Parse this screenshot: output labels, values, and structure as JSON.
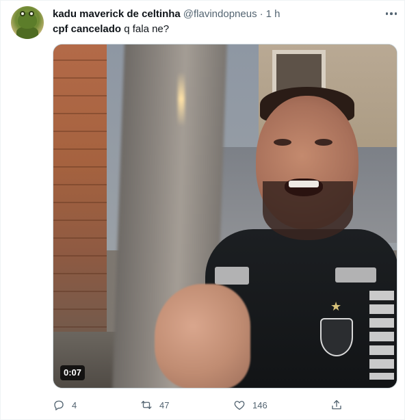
{
  "tweet": {
    "author_name": "kadu maverick de celtinha",
    "handle": "@flavindopneus",
    "separator": "·",
    "time": "1 h",
    "text_bold": "cpf cancelado",
    "text_rest": " q fala ne?"
  },
  "media": {
    "duration": "0:07"
  },
  "actions": {
    "replies": "4",
    "retweets": "47",
    "likes": "146"
  },
  "icons": {
    "more": "more-horizontal-icon",
    "reply": "reply-icon",
    "retweet": "retweet-icon",
    "like": "heart-icon",
    "share": "share-icon"
  },
  "colors": {
    "primary_text": "#0f1419",
    "secondary_text": "#536471",
    "border": "#cfd9de"
  }
}
